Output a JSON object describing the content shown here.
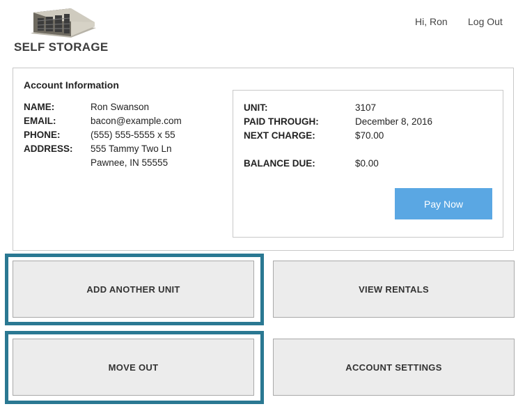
{
  "brand": {
    "name": "SELF STORAGE"
  },
  "header": {
    "greeting": "Hi, Ron",
    "logout_label": "Log Out"
  },
  "account": {
    "title": "Account Information",
    "fields": [
      {
        "label": "NAME:",
        "value": "Ron Swanson"
      },
      {
        "label": "EMAIL:",
        "value": "bacon@example.com"
      },
      {
        "label": "PHONE:",
        "value": "(555) 555-5555 x 55"
      },
      {
        "label": "ADDRESS:",
        "value": "555 Tammy Two Ln"
      }
    ],
    "address_line2": "Pawnee, IN 55555"
  },
  "billing": {
    "unit_label": "UNIT:",
    "unit": "3107",
    "paid_through_label": "PAID THROUGH:",
    "paid_through": "December 8, 2016",
    "next_charge_label": "NEXT CHARGE:",
    "next_charge": "$70.00",
    "balance_label": "BALANCE DUE:",
    "balance": "$0.00",
    "pay_label": "Pay Now"
  },
  "actions": {
    "add_unit": "ADD ANOTHER UNIT",
    "view_rentals": "VIEW RENTALS",
    "move_out": "MOVE OUT",
    "account_settings": "ACCOUNT SETTINGS"
  },
  "colors": {
    "accent": "#5aa7e3",
    "highlight": "#2a7892",
    "button_bg": "#ececec"
  }
}
